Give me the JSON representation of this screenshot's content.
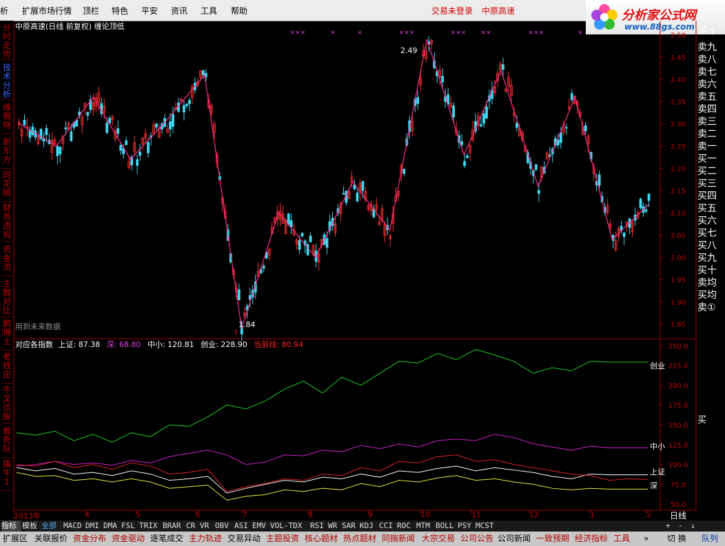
{
  "menu": {
    "items": [
      "析",
      "扩展市场行情",
      "顶栏",
      "特色",
      "平安",
      "资讯",
      "工具",
      "帮助"
    ],
    "status_left": "交易未登录",
    "status_right": "中原高速"
  },
  "logo": {
    "title": "分析家公式网",
    "url": "www.88gs.com",
    "corner": "买十"
  },
  "left_tabs": [
    "分时走势",
    "技术分析",
    "维赛特",
    "新东方",
    "同花顺",
    "财务透视",
    "资金流",
    "主散对比",
    "鹏博士",
    "老钱庄",
    "牛叉诊股",
    "敢死队",
    "擒牛1"
  ],
  "chart_header": {
    "title": "中原高速(日线 前复权) 缠论顶低",
    "note": "用到未来数据"
  },
  "main_chart": {
    "price_ticks": [
      "2.50",
      "2.45",
      "2.40",
      "2.35",
      "2.30",
      "2.25",
      "2.20",
      "2.15",
      "2.10",
      "2.05",
      "2.00",
      "1.95",
      "1.90",
      "1.85"
    ],
    "high_label": "2.49",
    "low_label": "1.84",
    "signal_glyph": "⇧",
    "marks": [
      "×××",
      "×",
      "×",
      "×××",
      "×××",
      "××",
      "×××",
      "×"
    ]
  },
  "index_panel": {
    "title": "对应各指数",
    "sh_label": "上证:",
    "sh_value": "87.38",
    "sz_label": "深:",
    "sz_value": "68.80",
    "zx_label": "中小:",
    "zx_value": "120.81",
    "cy_label": "创业:",
    "cy_value": "228.90",
    "cur_label": "当前线:",
    "cur_value": "80.94",
    "ticks": [
      "250.0",
      "225.0",
      "200.0",
      "175.0",
      "150.0",
      "125.0",
      "100.0",
      "75.0",
      "50.0"
    ],
    "line_tags": {
      "cy": "创业",
      "zx": "中小",
      "sh": "上证",
      "sz": "深"
    },
    "colors": {
      "cy": "#22cc22",
      "zx": "#cc22cc",
      "sh": "#ffffff",
      "sz": "#e8e840",
      "cur": "#dd2222"
    }
  },
  "right_panel": {
    "items": [
      "卖九",
      "卖八",
      "卖七",
      "卖六",
      "卖五",
      "卖四",
      "卖三",
      "卖二",
      "卖一",
      "买一",
      "买二",
      "买三",
      "买四",
      "买五",
      "买六",
      "买七",
      "买八",
      "买九",
      "买十",
      "卖均",
      "买均",
      "卖①"
    ],
    "lower_label": "买"
  },
  "time_axis": {
    "labels": [
      "2013年",
      "4",
      "5",
      "6",
      "7",
      "8",
      "9",
      "10",
      "11",
      "12",
      "1",
      "2"
    ],
    "period": "日线"
  },
  "indicator_tabs": [
    "指标",
    "模板",
    "全部",
    "MACD",
    "DMI",
    "DMA",
    "FSL",
    "TRIX",
    "BRAR",
    "CR",
    "VR",
    "OBV",
    "ASI",
    "EMV",
    "VOL-TDX",
    "RSI",
    "WR",
    "SAR",
    "KDJ",
    "CCI",
    "ROC",
    "MTM",
    "BOLL",
    "PSY",
    "MCST"
  ],
  "nav_controls": {
    "plus": "+",
    "minus": "-",
    "down": "↓"
  },
  "bottom_tabs": [
    "扩展区",
    "关联报价",
    "资金分布",
    "资金驱动",
    "逐笔成交",
    "主力轨迹",
    "交易异动",
    "主题投资",
    "核心题材",
    "热点题材",
    "同揣新闻",
    "大宗交易",
    "公司公告",
    "公司新闻",
    "一致预期",
    "经济指标",
    "工具",
    "»",
    "切 换",
    "队列"
  ],
  "chart_data": [
    {
      "type": "line",
      "title": "中原高速(日线 前复权) 缠论顶低",
      "series": [
        {
          "name": "缠论顶低",
          "points": [
            [
              0,
              2.3
            ],
            [
              1,
              2.25
            ],
            [
              2,
              2.36
            ],
            [
              3,
              2.22
            ],
            [
              4,
              2.31
            ],
            [
              5,
              2.41
            ],
            [
              6,
              1.84
            ],
            [
              7,
              2.1
            ],
            [
              8,
              2.0
            ],
            [
              9,
              2.17
            ],
            [
              10,
              2.06
            ],
            [
              11,
              2.49
            ],
            [
              12,
              2.23
            ],
            [
              13,
              2.42
            ],
            [
              14,
              2.16
            ],
            [
              15,
              2.36
            ],
            [
              16,
              2.04
            ],
            [
              17,
              2.12
            ]
          ]
        }
      ],
      "ylim": [
        1.82,
        2.51
      ],
      "x_range": [
        0,
        17
      ]
    },
    {
      "type": "line",
      "title": "对应各指数",
      "series": [
        {
          "name": "创业",
          "values": [
            140,
            137,
            142,
            130,
            138,
            128,
            140,
            135,
            150,
            148,
            160,
            175,
            170,
            180,
            195,
            205,
            190,
            210,
            200,
            215,
            230,
            228,
            240,
            232,
            245,
            238,
            230,
            215,
            222,
            218,
            230,
            229,
            229,
            229
          ]
        },
        {
          "name": "中小",
          "values": [
            98,
            100,
            104,
            100,
            102,
            99,
            105,
            102,
            110,
            114,
            118,
            112,
            100,
            103,
            112,
            111,
            118,
            116,
            124,
            120,
            126,
            122,
            130,
            132,
            130,
            138,
            134,
            126,
            122,
            118,
            123,
            121,
            121,
            121
          ]
        },
        {
          "name": "上证",
          "values": [
            96,
            92,
            95,
            88,
            90,
            86,
            92,
            88,
            80,
            82,
            85,
            64,
            70,
            75,
            80,
            78,
            84,
            82,
            88,
            84,
            92,
            90,
            95,
            98,
            92,
            96,
            93,
            90,
            85,
            82,
            88,
            87,
            87,
            87
          ]
        },
        {
          "name": "深",
          "values": [
            90,
            85,
            86,
            80,
            82,
            78,
            82,
            78,
            70,
            72,
            74,
            55,
            60,
            62,
            68,
            66,
            70,
            68,
            76,
            72,
            80,
            78,
            83,
            86,
            80,
            82,
            78,
            75,
            70,
            68,
            70,
            69,
            69,
            69
          ]
        },
        {
          "name": "当前线",
          "values": [
            100,
            98,
            104,
            96,
            100,
            94,
            102,
            98,
            88,
            90,
            94,
            66,
            72,
            76,
            82,
            80,
            88,
            86,
            96,
            92,
            104,
            102,
            110,
            112,
            104,
            106,
            100,
            96,
            92,
            88,
            86,
            80,
            82,
            81
          ]
        }
      ],
      "ylim": [
        45,
        255
      ]
    }
  ]
}
